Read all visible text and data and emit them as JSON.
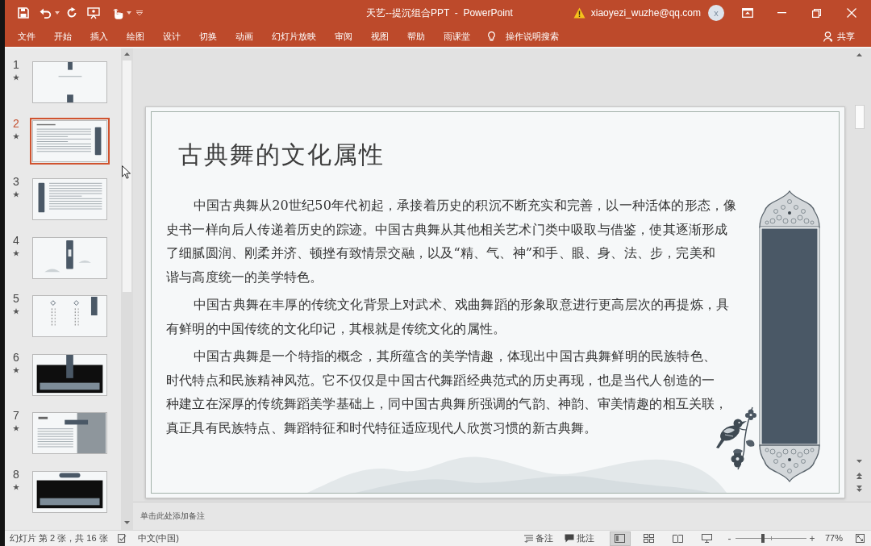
{
  "title_bar": {
    "title": "天艺--提沉组合PPT  -  PowerPoint",
    "account": "xiaoyezi_wuzhe@qq.com",
    "avatar_initial": "x"
  },
  "ribbon_tabs": [
    "文件",
    "开始",
    "插入",
    "绘图",
    "设计",
    "切换",
    "动画",
    "幻灯片放映",
    "审阅",
    "视图",
    "帮助",
    "雨课堂"
  ],
  "tell_me": "操作说明搜索",
  "share": "共享",
  "slides": [
    {
      "number": "1",
      "selected": false,
      "kind": "title"
    },
    {
      "number": "2",
      "selected": true,
      "kind": "text-scroll"
    },
    {
      "number": "3",
      "selected": false,
      "kind": "scroll-text"
    },
    {
      "number": "4",
      "selected": false,
      "kind": "center-scroll"
    },
    {
      "number": "5",
      "selected": false,
      "kind": "two-columns"
    },
    {
      "number": "6",
      "selected": false,
      "kind": "photo-banner"
    },
    {
      "number": "7",
      "selected": false,
      "kind": "text-photo"
    },
    {
      "number": "8",
      "selected": false,
      "kind": "photo-label"
    }
  ],
  "slide": {
    "title": "古典舞的文化属性",
    "paragraphs": [
      {
        "lines": [
          "中国古典舞从20世纪50年代初起，承接着历史的积沉不断充实和完善，以一种活体的形态，像",
          "史书一样向后人传递着历史的踪迹。中国古典舞从其他相关艺术门类中吸取与借鉴，使其逐渐形成",
          "了细腻圆润、刚柔并济、顿挫有致情景交融，以及“精、气、神”和手、眼、身、法、步，完美和",
          "谐与高度统一的美学特色。"
        ]
      },
      {
        "lines": [
          "中国古典舞在丰厚的传统文化背景上对武术、戏曲舞蹈的形象取意进行更高层次的再提炼，具",
          "有鲜明的中国传统的文化印记，其根就是传统文化的属性。"
        ]
      },
      {
        "lines": [
          "中国古典舞是一个特指的概念，其所蕴含的美学情趣，体现出中国古典舞鲜明的民族特色、",
          "时代特点和民族精神风范。它不仅仅是中国古代舞蹈经典范式的历史再现，也是当代人创造的一",
          "种建立在深厚的传统舞蹈美学基础上，同中国古典舞所强调的气韵、神韵、审美情趣的相互关联，",
          "真正具有民族特点、舞蹈特征和时代特征适应现代人欣赏习惯的新古典舞。"
        ]
      }
    ]
  },
  "notes": {
    "placeholder": "单击此处添加备注"
  },
  "status_bar": {
    "slide_info": "幻灯片 第 2 张，共 16 张",
    "language": "中文(中国)",
    "notes_button": "备注",
    "comments_button": "批注",
    "view_buttons": [
      {
        "kind": "normal",
        "selected": true
      },
      {
        "kind": "sorter",
        "selected": false
      },
      {
        "kind": "reading",
        "selected": false
      },
      {
        "kind": "slideshow",
        "selected": false
      }
    ],
    "zoom": {
      "minus": "-",
      "level": 0.39,
      "plus": "+",
      "reading": "77%"
    }
  }
}
